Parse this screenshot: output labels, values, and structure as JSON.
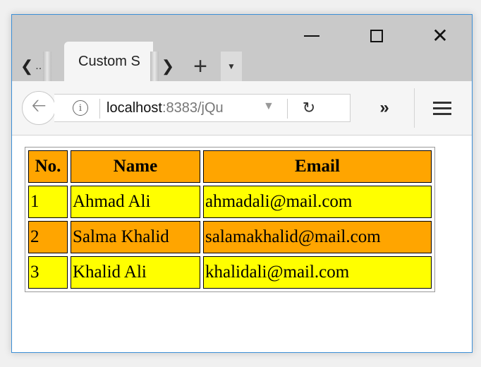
{
  "browser": {
    "tab_scroll_label": "..",
    "tab_title": "Custom S",
    "url_host": "localhost",
    "url_rest": ":8383/jQu",
    "icons": {
      "back": "back-arrow-icon",
      "info": "info-icon",
      "reload": "reload-icon",
      "overflow": "double-chevron-icon",
      "menu": "hamburger-menu-icon"
    }
  },
  "table": {
    "headers": [
      "No.",
      "Name",
      "Email"
    ],
    "rows": [
      {
        "no": "1",
        "name": "Ahmad Ali",
        "email": "ahmadali@mail.com"
      },
      {
        "no": "2",
        "name": "Salma Khalid",
        "email": "salamakhalid@mail.com"
      },
      {
        "no": "3",
        "name": "Khalid Ali",
        "email": "khalidali@mail.com"
      }
    ],
    "colors": {
      "header": "#ffa500",
      "odd_row": "#ffff00",
      "even_row": "#ffa500"
    }
  }
}
